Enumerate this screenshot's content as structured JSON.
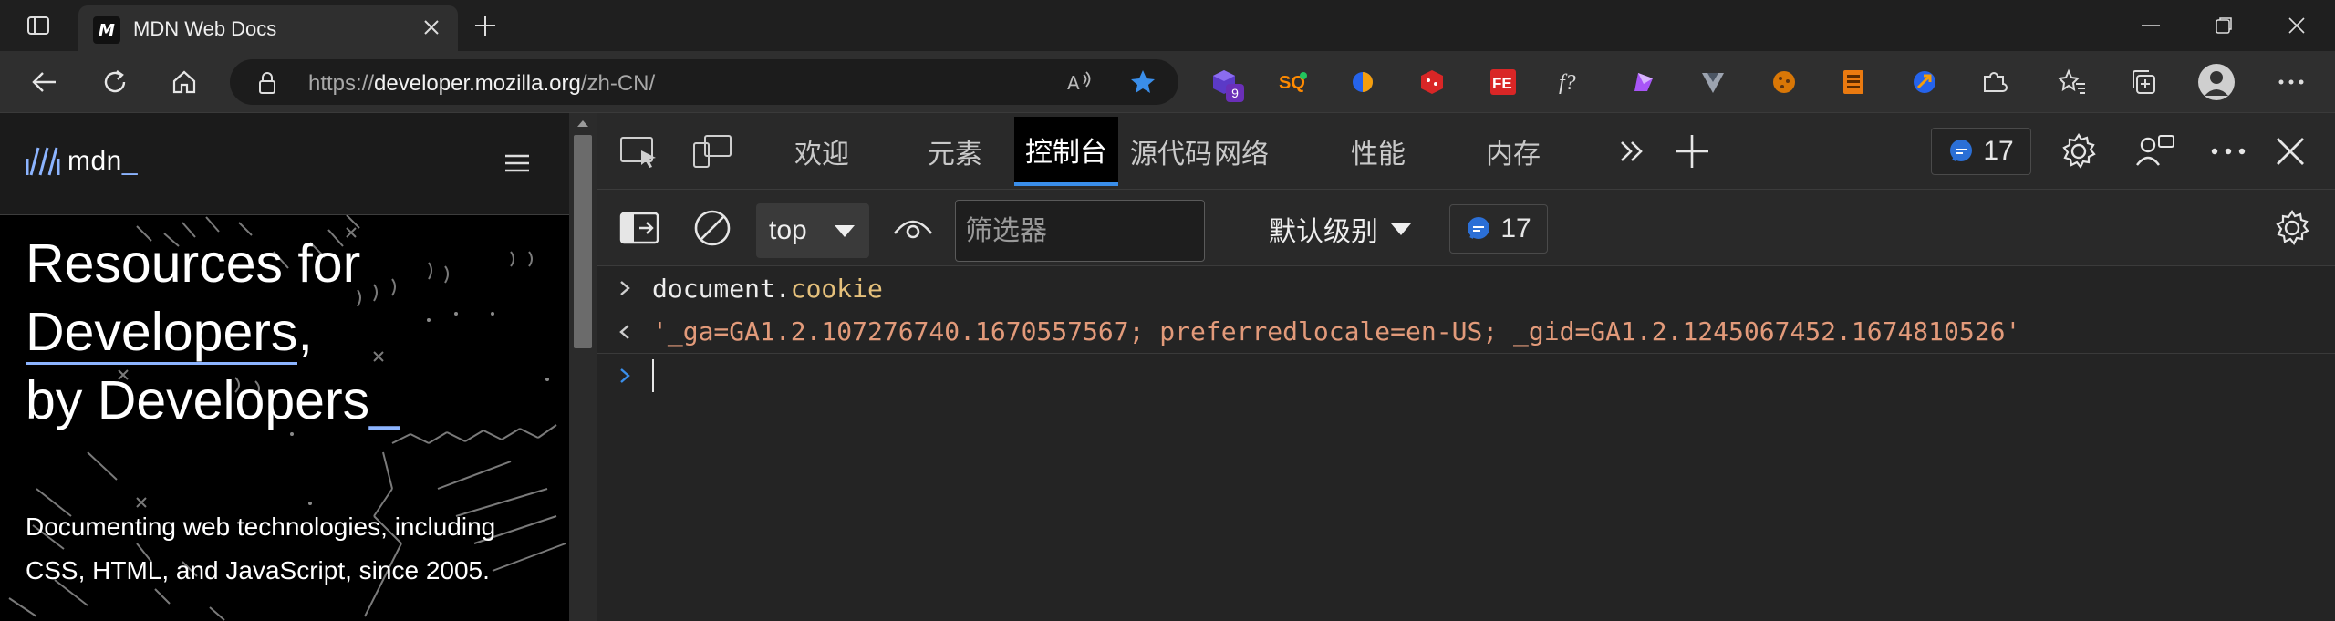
{
  "browser": {
    "tab": {
      "title": "MDN Web Docs",
      "favicon_text": "M"
    },
    "address": {
      "scheme": "https://",
      "host": "developer.mozilla.org",
      "path": "/zh-CN/"
    },
    "extensions": [
      {
        "icon": "purple-cube-icon",
        "badge": "9"
      },
      {
        "icon": "sq-extension-icon"
      },
      {
        "icon": "blue-orange-circle-icon"
      },
      {
        "icon": "red-cube-icon"
      },
      {
        "icon": "fe-helper-icon",
        "label": "FE"
      },
      {
        "icon": "function-icon",
        "label": "f?"
      },
      {
        "icon": "purple-shape-icon"
      },
      {
        "icon": "v-shape-icon"
      },
      {
        "icon": "cookie-icon"
      },
      {
        "icon": "orange-box-icon"
      },
      {
        "icon": "globe-arrow-icon"
      },
      {
        "icon": "puzzle-icon"
      },
      {
        "icon": "favorites-icon"
      },
      {
        "icon": "collections-icon"
      },
      {
        "icon": "profile-avatar-icon"
      },
      {
        "icon": "more-icon"
      }
    ]
  },
  "mdn": {
    "logo_text": "mdn",
    "logo_underscore": "_",
    "hero_line1": "Resources for",
    "hero_line2": "Developers",
    "hero_comma": ",",
    "hero_line3": "by Developers",
    "hero_cursor": "_",
    "description": "Documenting web technologies, including CSS, HTML, and JavaScript, since 2005."
  },
  "devtools": {
    "tabs": [
      "欢迎",
      "元素",
      "控制台",
      "源代码",
      "网络",
      "性能",
      "内存"
    ],
    "active_tab": "控制台",
    "issues_count": "17",
    "toolbar": {
      "context": "top",
      "filter_placeholder": "筛选器",
      "levels": "默认级别",
      "issues_count": "17"
    },
    "console": {
      "input_obj": "document",
      "input_dot": ".",
      "input_prop": "cookie",
      "output": "'_ga=GA1.2.107276740.1670557567; preferredlocale=en-US; _gid=GA1.2.1245067452.1674810526'"
    }
  },
  "colors": {
    "accent": "#3a8eea",
    "mdn_blue": "#8cb4ff",
    "string": "#e29a7a",
    "property": "#e5c07b"
  }
}
